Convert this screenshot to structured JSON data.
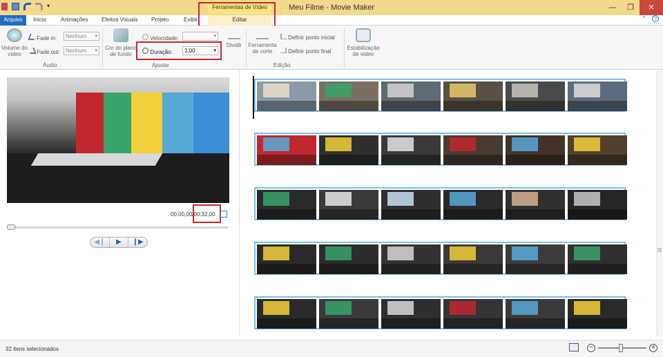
{
  "titlebar": {
    "title": "Meu Filme - Movie Maker",
    "context_header": "Ferramentas de Vídeo"
  },
  "tabs": [
    {
      "label": "Arquivo"
    },
    {
      "label": "Início"
    },
    {
      "label": "Animações"
    },
    {
      "label": "Efeitos Visuais"
    },
    {
      "label": "Projeto"
    },
    {
      "label": "Exibir"
    },
    {
      "label": "Editar"
    }
  ],
  "ribbon": {
    "audio": {
      "volume_label": "Volume do vídeo",
      "fade_in_label": "Fade in:",
      "fade_in_value": "Nenhum",
      "fade_out_label": "Fade out:",
      "fade_out_value": "Nenhum",
      "group_label": "Áudio"
    },
    "adjust": {
      "bg_color_label": "Cor do plano de fundo",
      "speed_label": "Velocidade:",
      "duration_label": "Duração:",
      "duration_value": "1,00",
      "split_label": "Dividir",
      "group_label": "Ajustar"
    },
    "edit": {
      "trim_label": "Ferramenta de corte",
      "set_start_label": "Definir ponto inicial",
      "set_end_label": "Definir ponto final",
      "group_label": "Edição"
    },
    "stabilization_label": "Estabilização de vídeo"
  },
  "preview": {
    "timecode_current": "00:00,00/",
    "timecode_total": "00:32,00"
  },
  "storyboard": {
    "rows": [
      {
        "clips": [
          {
            "bg": "#8a9aa8",
            "accent": "#e8e0c8"
          },
          {
            "bg": "#7a6f62",
            "accent": "#3aa36b"
          },
          {
            "bg": "#5e6a74",
            "accent": "#d2d2d2"
          },
          {
            "bg": "#5a5044",
            "accent": "#e9c86a"
          },
          {
            "bg": "#4a4a48",
            "accent": "#c8c4bc"
          },
          {
            "bg": "#5c6c7c",
            "accent": "#dcdcdc"
          }
        ]
      },
      {
        "clips": [
          {
            "bg": "#c0282e",
            "accent": "#57a9d8"
          },
          {
            "bg": "#2f2f2f",
            "accent": "#f2d03a"
          },
          {
            "bg": "#3a3a3a",
            "accent": "#dfe6ea"
          },
          {
            "bg": "#4a3b30",
            "accent": "#c0282e"
          },
          {
            "bg": "#42332a",
            "accent": "#57a9d8"
          },
          {
            "bg": "#504030",
            "accent": "#f2d03a"
          }
        ]
      },
      {
        "clips": [
          {
            "bg": "#2a2a2a",
            "accent": "#3aa36b"
          },
          {
            "bg": "#3a3a3a",
            "accent": "#e8e8e8"
          },
          {
            "bg": "#2f2f2f",
            "accent": "#c8e0f0"
          },
          {
            "bg": "#2a2a2a",
            "accent": "#57a9d8"
          },
          {
            "bg": "#303030",
            "accent": "#d8b090"
          },
          {
            "bg": "#262626",
            "accent": "#c8c8c8"
          }
        ]
      },
      {
        "clips": [
          {
            "bg": "#2a2a2a",
            "accent": "#f2d03a"
          },
          {
            "bg": "#2c2c2c",
            "accent": "#3aa36b"
          },
          {
            "bg": "#333333",
            "accent": "#d8d8d8"
          },
          {
            "bg": "#3a3a3a",
            "accent": "#f2d03a"
          },
          {
            "bg": "#3c3c3c",
            "accent": "#57a9d8"
          },
          {
            "bg": "#303030",
            "accent": "#3aa36b"
          }
        ]
      },
      {
        "clips": [
          {
            "bg": "#2a2a2a",
            "accent": "#f2d03a"
          },
          {
            "bg": "#3a3a3a",
            "accent": "#3aa36b"
          },
          {
            "bg": "#2f2f2f",
            "accent": "#d8d8d8"
          },
          {
            "bg": "#353535",
            "accent": "#c0282e"
          },
          {
            "bg": "#3a3a3a",
            "accent": "#57a9d8"
          },
          {
            "bg": "#2a2a2a",
            "accent": "#f2d03a"
          }
        ]
      }
    ]
  },
  "status": {
    "selection_text": "32 itens selecionados"
  },
  "colors": {
    "titlebar": "#f3d98c",
    "file_tab": "#1e6ec0",
    "highlight_box": "#c8262a",
    "storyboard_strip": "#7cbde8"
  }
}
